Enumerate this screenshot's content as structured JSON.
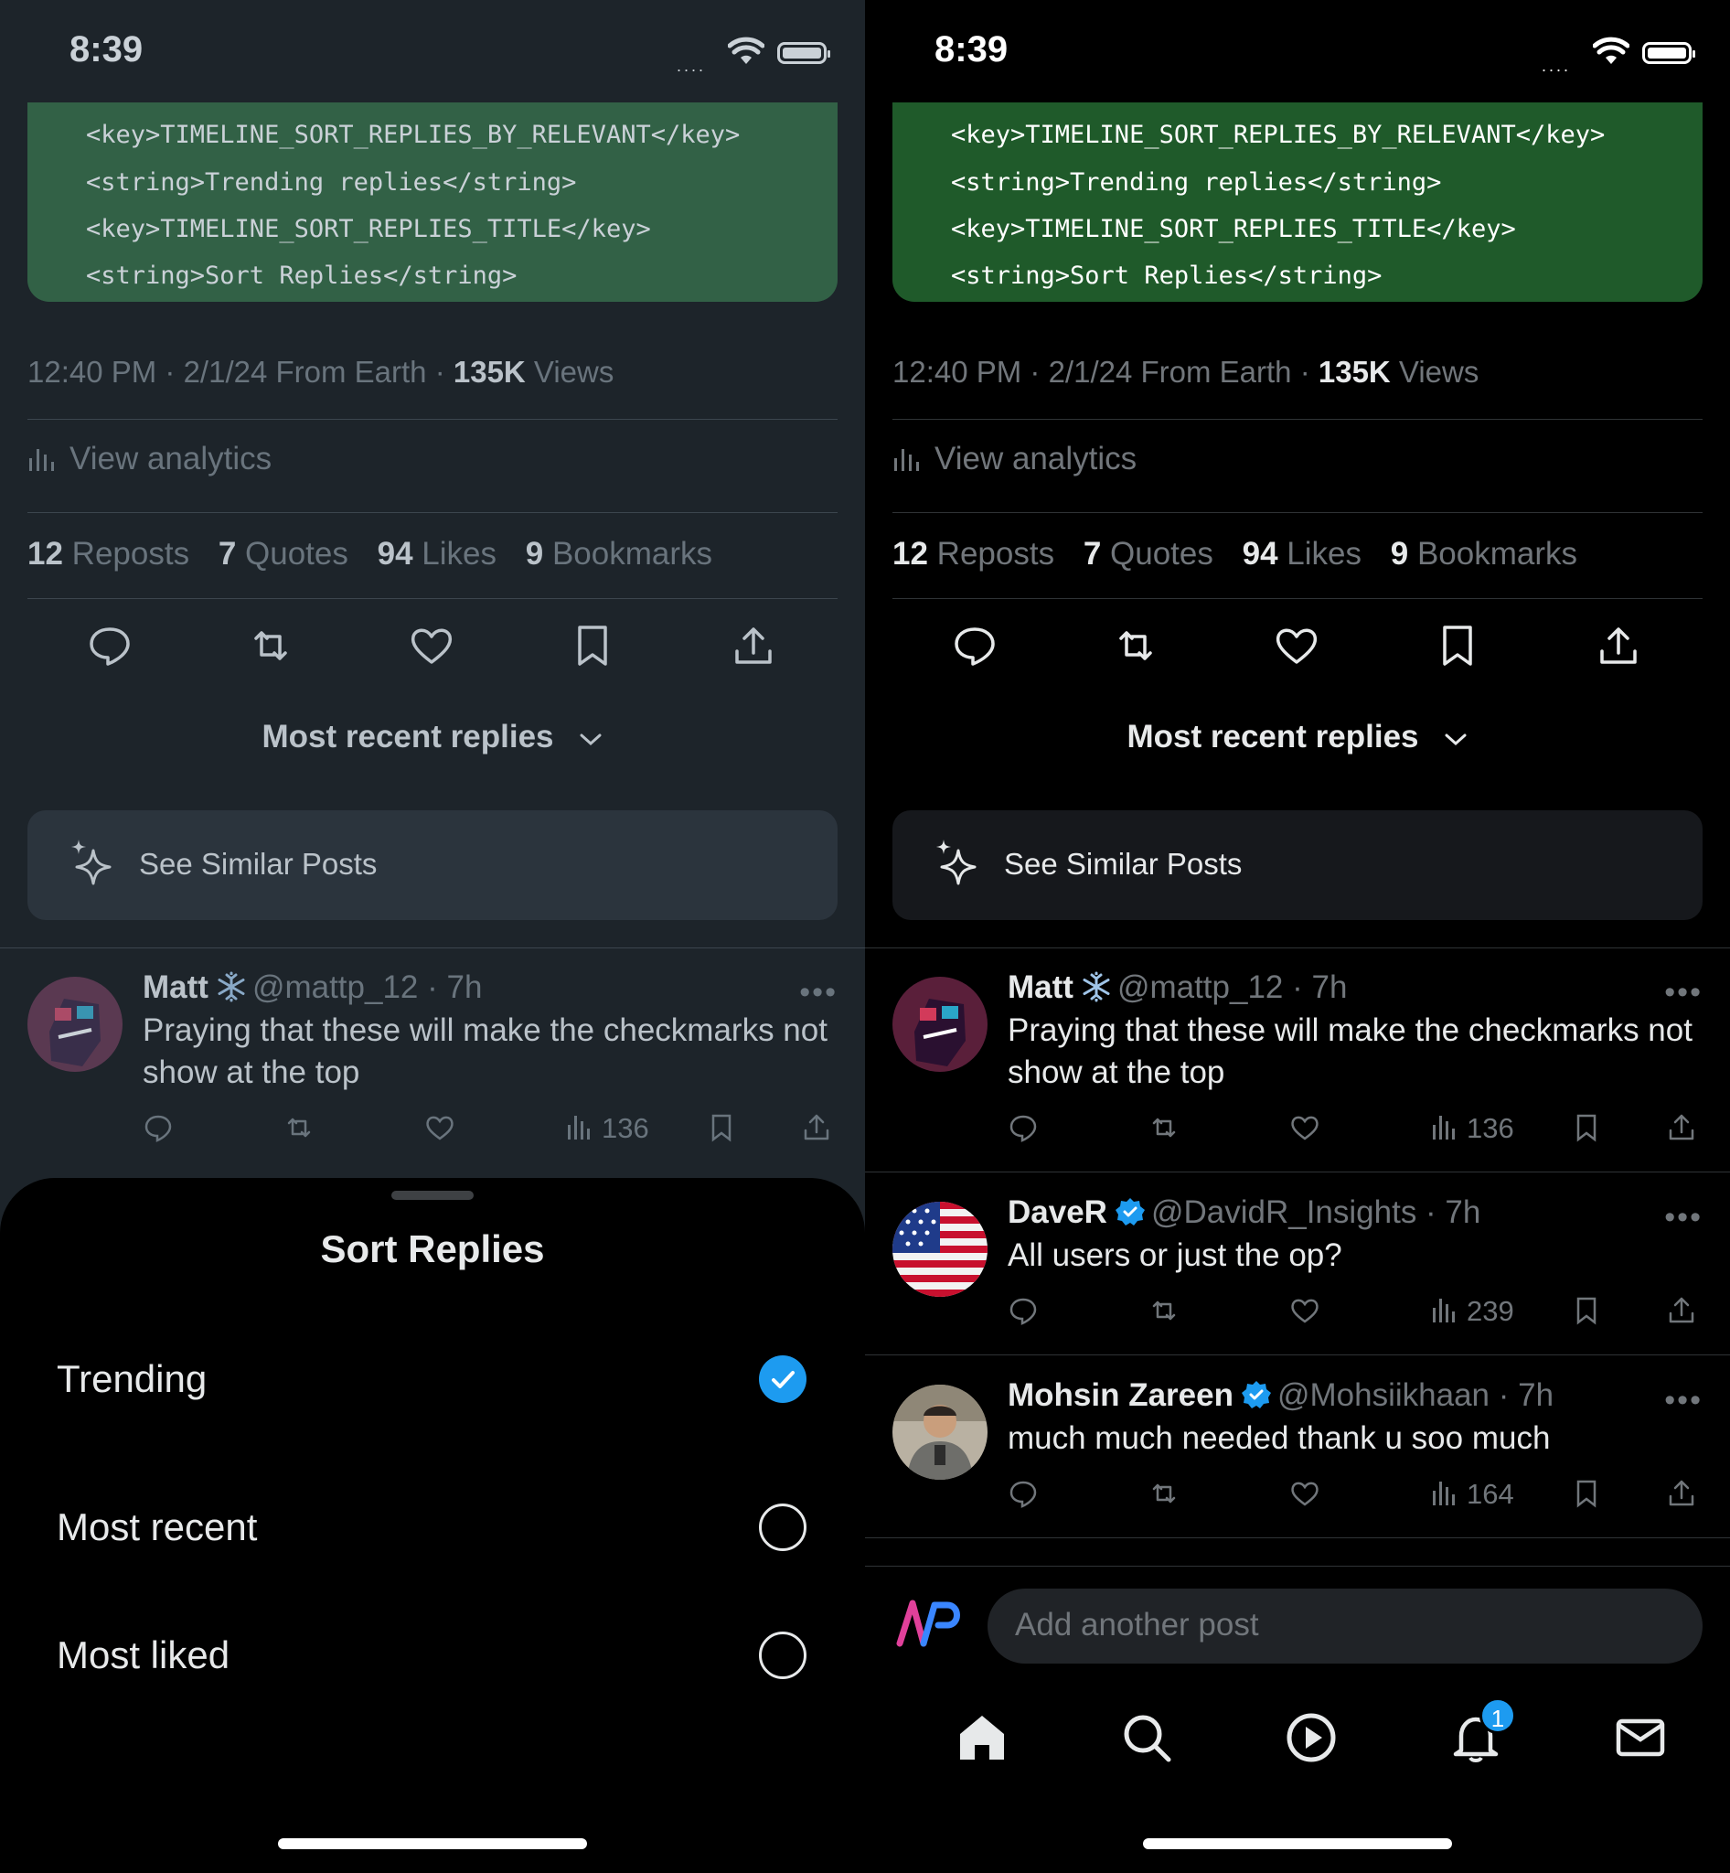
{
  "status": {
    "time": "8:39"
  },
  "code_lines": [
    "<key>TIMELINE_SORT_REPLIES_BY_RELEVANT</key>",
    "<string>Trending replies</string>",
    "<key>TIMELINE_SORT_REPLIES_TITLE</key>",
    "<string>Sort Replies</string>"
  ],
  "post_meta": {
    "text": "12:40 PM · 2/1/24 From Earth · ",
    "views_count": "135K",
    "views_label": " Views"
  },
  "analytics_label": "View analytics",
  "engagement": [
    {
      "count": "12",
      "label": "Reposts"
    },
    {
      "count": "7",
      "label": "Quotes"
    },
    {
      "count": "94",
      "label": "Likes"
    },
    {
      "count": "9",
      "label": "Bookmarks"
    }
  ],
  "sort_button_label": "Most recent replies",
  "see_similar_label": "See Similar Posts",
  "replies": [
    {
      "name": "Matt",
      "handle": "@mattp_12 · 7h",
      "text": "Praying that these will make the checkmarks not show at the top",
      "views": "136",
      "badge": "snowflake-icon"
    },
    {
      "name": "DaveR",
      "handle": "@DavidR_Insights · 7h",
      "text": "All users or just the op?",
      "views": "239",
      "badge": "verified-badge-icon"
    },
    {
      "name": "Mohsin Zareen",
      "handle": "@Mohsiikhaan · 7h",
      "text": "much much needed thank u soo much",
      "views": "164",
      "badge": "verified-badge-icon"
    }
  ],
  "composer_placeholder": "Add another post",
  "notification_count": "1",
  "sheet": {
    "title": "Sort Replies",
    "options": [
      {
        "label": "Trending",
        "selected": true
      },
      {
        "label": "Most recent",
        "selected": false
      },
      {
        "label": "Most liked",
        "selected": false
      }
    ]
  },
  "colors": {
    "accent": "#1d9bf0",
    "code_bg": "#1f5a2a",
    "background": "#000000",
    "secondary_text": "#71767b"
  }
}
